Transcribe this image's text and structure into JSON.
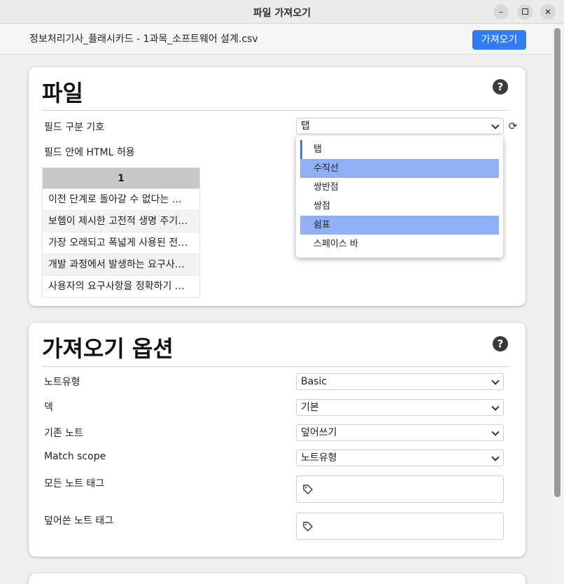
{
  "window": {
    "title": "파일 가져오기",
    "minimize_label": "–",
    "close_label": "✕"
  },
  "header": {
    "filename": "정보처리기사_플래시카드 - 1과목_소프트웨어 설계.csv",
    "import_button": "가져오기"
  },
  "file_section": {
    "title": "파일",
    "help": "?",
    "field_separator_label": "필드 구분 기호",
    "field_separator_value": "탭",
    "allow_html_label": "필드 안에 HTML 허용",
    "preview": {
      "column_header": "1",
      "rows": [
        "이전 단계로 돌아갈 수 없다는 …",
        "보헴이 제시한 고전적 생명 주기…",
        "가장 오래되고 폭넓게 사용된 전…",
        "개발 과정에서 발생하는 요구사…",
        "사용자의 요구사항을 정확하기 …"
      ]
    }
  },
  "separator_dropdown": {
    "options": [
      "탭",
      "수직선",
      "쌍반점",
      "쌍점",
      "쉼표",
      "스페이스 바"
    ],
    "highlighted": [
      "수직선",
      "쉼표"
    ]
  },
  "import_options": {
    "title": "가져오기 옵션",
    "help": "?",
    "note_type_label": "노트유형",
    "note_type_value": "Basic",
    "deck_label": "덱",
    "deck_value": "기본",
    "existing_notes_label": "기존 노트",
    "existing_notes_value": "덮어쓰기",
    "match_scope_label": "Match scope",
    "match_scope_value": "노트유형",
    "all_notes_tags_label": "모든 노트 태그",
    "updated_notes_tags_label": "덮어쓴 노트 태그"
  },
  "colors": {
    "accent": "#2f7cf6",
    "dropdown_highlight": "#91aff5",
    "table_header": "#c8c8c8"
  },
  "icons": {
    "help": "question-circle-icon",
    "reset": "reset-icon",
    "tag": "tag-icon",
    "chevron": "chevron-down-icon"
  }
}
